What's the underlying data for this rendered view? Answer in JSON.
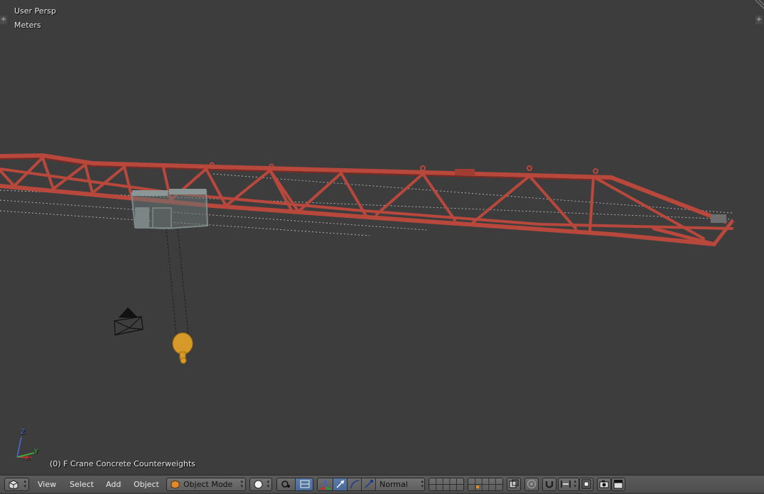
{
  "viewport": {
    "view_name": "User Persp",
    "units": "Meters",
    "object_info": "(0) F Crane Concrete Counterweights",
    "axes": {
      "x": "X",
      "y": "Y",
      "z": "Z"
    },
    "colors": {
      "background": "#3d3d3d",
      "crane": "#b8473c",
      "hook": "#d79a28"
    }
  },
  "header": {
    "editor_icon": "cube-icon",
    "menus": [
      "View",
      "Select",
      "Add",
      "Object"
    ],
    "mode": "Object Mode",
    "pivot_label": "Normal"
  }
}
